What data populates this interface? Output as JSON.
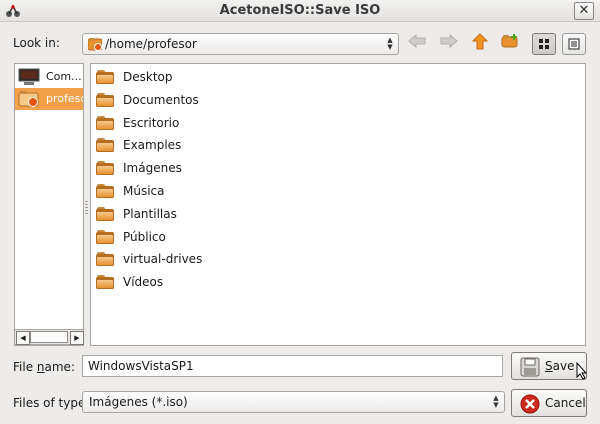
{
  "window": {
    "title": "AcetoneISO::Save ISO",
    "close_glyph": "✕"
  },
  "toolbar": {
    "look_in_label": "Look in:",
    "look_in_path": "/home/profesor",
    "nav_icons": [
      "back-arrow-icon",
      "forward-arrow-icon",
      "up-arrow-icon",
      "new-folder-icon",
      "icon-view-icon",
      "detail-view-icon"
    ]
  },
  "sidebar": {
    "items": [
      {
        "label": "Com...",
        "icon": "computer-icon",
        "selected": false
      },
      {
        "label": "profesor",
        "icon": "home-folder-icon",
        "selected": true
      }
    ]
  },
  "files": [
    {
      "name": "Desktop"
    },
    {
      "name": "Documentos"
    },
    {
      "name": "Escritorio"
    },
    {
      "name": "Examples"
    },
    {
      "name": "Imágenes"
    },
    {
      "name": "Música"
    },
    {
      "name": "Plantillas"
    },
    {
      "name": "Público"
    },
    {
      "name": "virtual-drives"
    },
    {
      "name": "Vídeos"
    }
  ],
  "filename": {
    "label_prefix": "File ",
    "label_underlined": "n",
    "label_suffix": "ame:",
    "value": "WindowsVistaSP1"
  },
  "filetype": {
    "label": "Files of type:",
    "value": "Imágenes (*.iso)"
  },
  "buttons": {
    "save": {
      "underlined": "S",
      "rest": "ave"
    },
    "cancel": {
      "label": "Cancel"
    }
  },
  "colors": {
    "selection": "#f3a04a",
    "folder": "#e7922e",
    "up_arrow": "#e88a1a",
    "cancel_red": "#cc2a1d"
  }
}
